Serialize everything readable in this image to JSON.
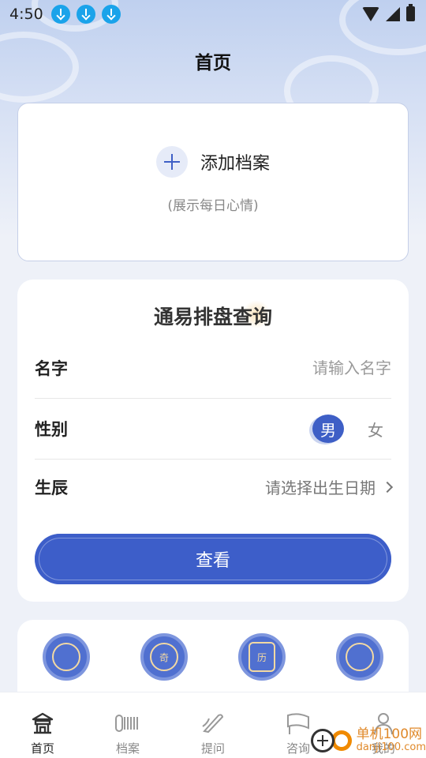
{
  "status_bar": {
    "time": "4:50",
    "notifications": [
      "download-icon",
      "download-icon",
      "download-icon"
    ],
    "right_icons": [
      "wifi-icon",
      "signal-icon",
      "battery-charging-icon"
    ]
  },
  "header": {
    "title": "首页"
  },
  "profile_card": {
    "add_label": "添加档案",
    "hint": "(展示每日心情)"
  },
  "query_card": {
    "title": "通易排盘查询",
    "name_label": "名字",
    "name_placeholder": "请输入名字",
    "name_value": "",
    "gender_label": "性别",
    "gender_male": "男",
    "gender_female": "女",
    "gender_selected": "男",
    "birth_label": "生辰",
    "birth_placeholder": "请选择出生日期",
    "view_button": "查看"
  },
  "tools": [
    {
      "icon": "bagua-icon"
    },
    {
      "icon": "qimen-icon",
      "text": "奇"
    },
    {
      "icon": "calendar-icon",
      "text": "历"
    },
    {
      "icon": "compass-icon"
    }
  ],
  "tabbar": {
    "items": [
      {
        "label": "首页",
        "icon": "home-pavilion-icon",
        "active": true
      },
      {
        "label": "档案",
        "icon": "scroll-icon",
        "active": false
      },
      {
        "label": "提问",
        "icon": "brush-icon",
        "active": false
      },
      {
        "label": "咨询",
        "icon": "flag-icon",
        "active": false
      },
      {
        "label": "我的",
        "icon": "person-icon",
        "active": false
      }
    ]
  },
  "watermark": {
    "title": "单机100网",
    "url": "danji100.com"
  },
  "colors": {
    "accent": "#3d5ec9",
    "background": "#eef1f8",
    "watermark": "#e0892a"
  }
}
